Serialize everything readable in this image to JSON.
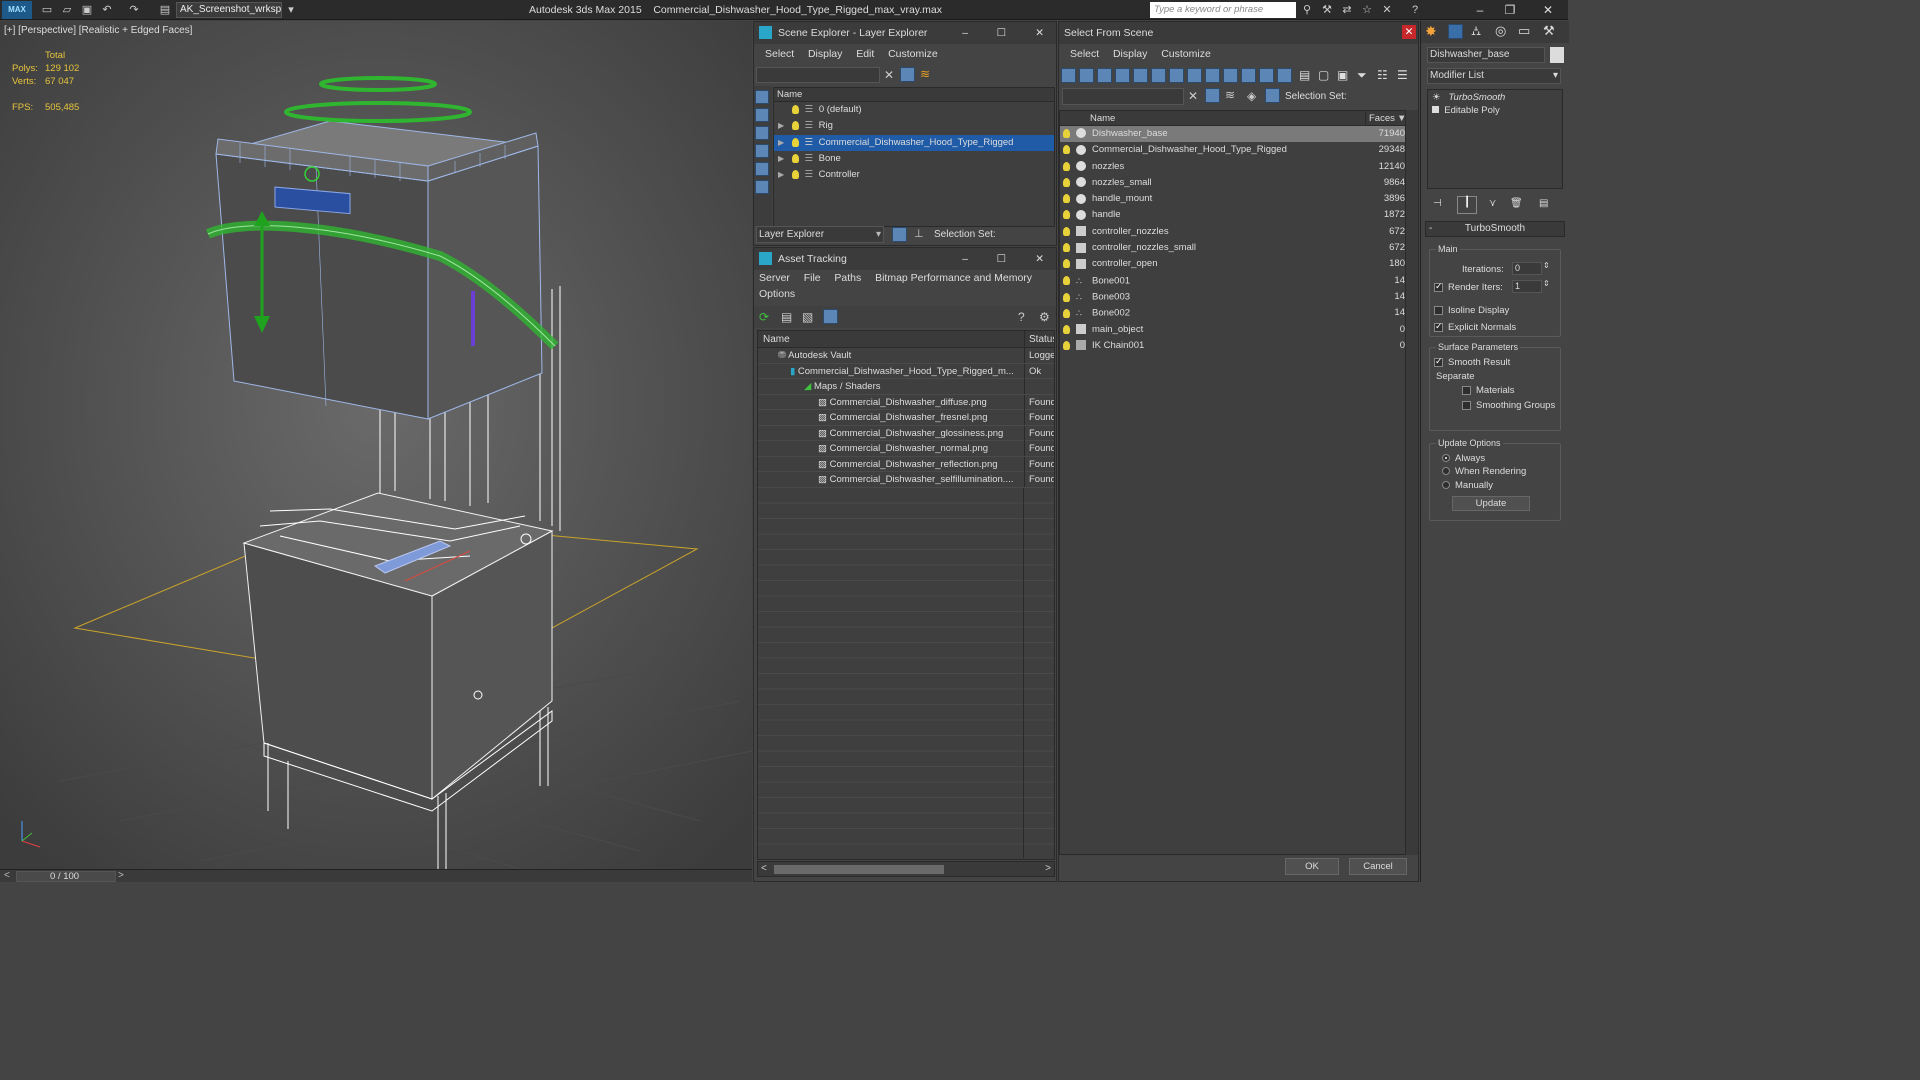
{
  "titlebar": {
    "workspace": "AK_Screenshot_wrksp",
    "app_name": "Autodesk 3ds Max  2015",
    "file_name": "Commercial_Dishwasher_Hood_Type_Rigged_max_vray.max",
    "search_placeholder": "Type a keyword or phrase",
    "logo_text": "MAX"
  },
  "viewport": {
    "label": "[+] [Perspective] [Realistic + Edged Faces]",
    "stats_header": "Total",
    "polys_label": "Polys:",
    "polys_value": "129 102",
    "verts_label": "Verts:",
    "verts_value": "67 047",
    "fps_label": "FPS:",
    "fps_value": "505,485"
  },
  "timeline": {
    "value": "0 / 100"
  },
  "layer_explorer": {
    "title": "Scene Explorer - Layer Explorer",
    "menu": [
      "Select",
      "Display",
      "Edit",
      "Customize"
    ],
    "col_name": "Name",
    "rows": [
      {
        "name": "0 (default)"
      },
      {
        "name": "Rig"
      },
      {
        "name": "Commercial_Dishwasher_Hood_Type_Rigged"
      },
      {
        "name": "Bone"
      },
      {
        "name": "Controller"
      }
    ],
    "footer_dropdown": "Layer Explorer",
    "selection_set": "Selection Set:"
  },
  "asset_tracking": {
    "title": "Asset Tracking",
    "menu": [
      "Server",
      "File",
      "Paths",
      "Bitmap Performance and Memory"
    ],
    "menu2": "Options",
    "col_name": "Name",
    "col_status": "Status",
    "rows": [
      {
        "name": "Autodesk Vault",
        "status": "Logge"
      },
      {
        "name": "Commercial_Dishwasher_Hood_Type_Rigged_m...",
        "status": "Ok"
      },
      {
        "name": "Maps / Shaders",
        "status": ""
      },
      {
        "name": "Commercial_Dishwasher_diffuse.png",
        "status": "Found"
      },
      {
        "name": "Commercial_Dishwasher_fresnel.png",
        "status": "Found"
      },
      {
        "name": "Commercial_Dishwasher_glossiness.png",
        "status": "Found"
      },
      {
        "name": "Commercial_Dishwasher_normal.png",
        "status": "Found"
      },
      {
        "name": "Commercial_Dishwasher_reflection.png",
        "status": "Found"
      },
      {
        "name": "Commercial_Dishwasher_selfillumination....",
        "status": "Found"
      }
    ]
  },
  "select_scene": {
    "title": "Select From Scene",
    "menu": [
      "Select",
      "Display",
      "Customize"
    ],
    "selection_set": "Selection Set:",
    "col_name": "Name",
    "col_faces": "Faces",
    "rows": [
      {
        "name": "Dishwasher_base",
        "faces": "71940"
      },
      {
        "name": "Commercial_Dishwasher_Hood_Type_Rigged",
        "faces": "29348"
      },
      {
        "name": "nozzles",
        "faces": "12140"
      },
      {
        "name": "nozzles_small",
        "faces": "9864"
      },
      {
        "name": "handle_mount",
        "faces": "3896"
      },
      {
        "name": "handle",
        "faces": "1872"
      },
      {
        "name": "controller_nozzles",
        "faces": "672"
      },
      {
        "name": "controller_nozzles_small",
        "faces": "672"
      },
      {
        "name": "controller_open",
        "faces": "180"
      },
      {
        "name": "Bone001",
        "faces": "14"
      },
      {
        "name": "Bone003",
        "faces": "14"
      },
      {
        "name": "Bone002",
        "faces": "14"
      },
      {
        "name": "main_object",
        "faces": "0"
      },
      {
        "name": "IK Chain001",
        "faces": "0"
      }
    ],
    "ok": "OK",
    "cancel": "Cancel"
  },
  "command_panel": {
    "object_name": "Dishwasher_base",
    "modifier_list": "Modifier List",
    "stack": [
      "TurboSmooth",
      "Editable Poly"
    ],
    "rollout_title": "TurboSmooth",
    "main_group": "Main",
    "iterations_label": "Iterations:",
    "iterations_value": "0",
    "render_iters_label": "Render Iters:",
    "render_iters_value": "1",
    "isoline": "Isoline Display",
    "explicit_normals": "Explicit Normals",
    "surface_group": "Surface Parameters",
    "smooth_result": "Smooth Result",
    "separate_label": "Separate",
    "materials": "Materials",
    "smoothing_groups": "Smoothing Groups",
    "update_group": "Update Options",
    "always": "Always",
    "when_rendering": "When Rendering",
    "manually": "Manually",
    "update_btn": "Update"
  },
  "colors": {
    "selection_blue": "#1f5ba7",
    "stats_yellow": "#e7c53b",
    "controller_green": "#2fb52f"
  }
}
